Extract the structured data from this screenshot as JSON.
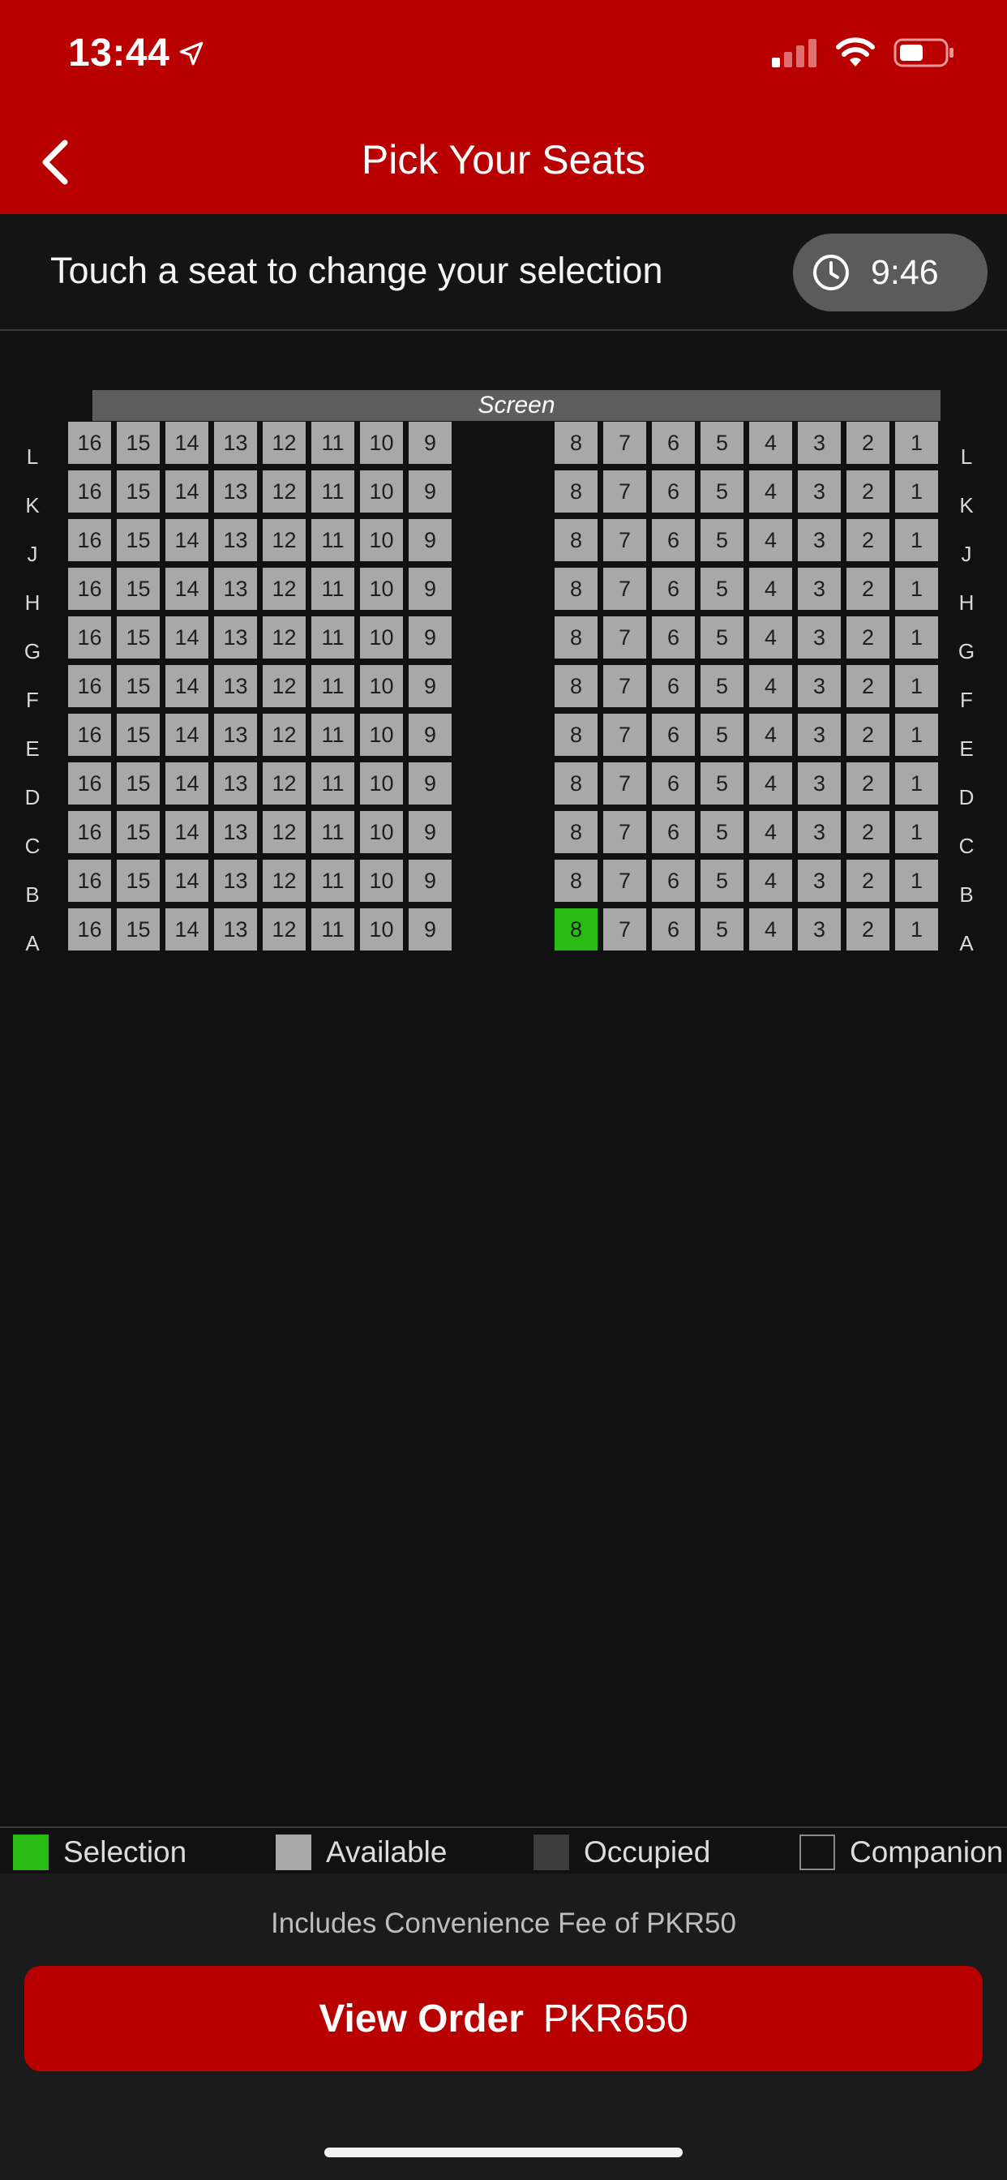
{
  "status_bar": {
    "time": "13:44"
  },
  "header": {
    "title": "Pick Your Seats"
  },
  "instruction": {
    "text": "Touch a seat to change your selection",
    "timer": "9:46"
  },
  "screen_label": "Screen",
  "rows": [
    "L",
    "K",
    "J",
    "H",
    "G",
    "F",
    "E",
    "D",
    "C",
    "B",
    "A"
  ],
  "left_seats": [
    "16",
    "15",
    "14",
    "13",
    "12",
    "11",
    "10",
    "9"
  ],
  "right_seats": [
    "8",
    "7",
    "6",
    "5",
    "4",
    "3",
    "2",
    "1"
  ],
  "selected_seat": {
    "row": "A",
    "seat": "8"
  },
  "legend": {
    "selection": "Selection",
    "available": "Available",
    "occupied": "Occupied",
    "companion": "Companion"
  },
  "colors": {
    "brand": "#b80000",
    "selection": "#27bb14",
    "available": "#a8a8a8",
    "occupied": "#3d3d3d"
  },
  "fee_note": "Includes Convenience Fee of PKR50",
  "order_button": {
    "label": "View Order",
    "price": "PKR650"
  }
}
